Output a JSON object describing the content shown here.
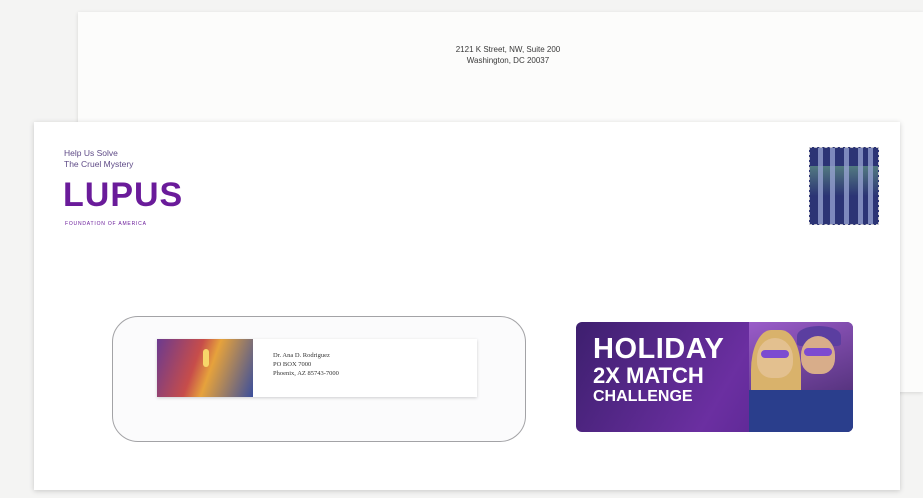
{
  "back_envelope": {
    "return_address_line1": "2121 K Street, NW, Suite 200",
    "return_address_line2": "Washington, DC 20037"
  },
  "front_envelope": {
    "tagline_line1": "Help Us Solve",
    "tagline_line2": "The Cruel Mystery",
    "logo_text": "LUPUS",
    "logo_subtitle": "FOUNDATION OF AMERICA",
    "stamp_icon": "winter-forest-stamp",
    "recipient": {
      "line1": "Dr. Ana D. Rodriguez",
      "line2": "PO BOX 7000",
      "line3": "Phoenix, AZ 85743-7000"
    },
    "banner": {
      "line1": "HOLIDAY",
      "line2": "2X MATCH",
      "line3": "CHALLENGE"
    }
  },
  "colors": {
    "brand_purple": "#6a1b9a",
    "banner_purple": "#5a2a94"
  }
}
